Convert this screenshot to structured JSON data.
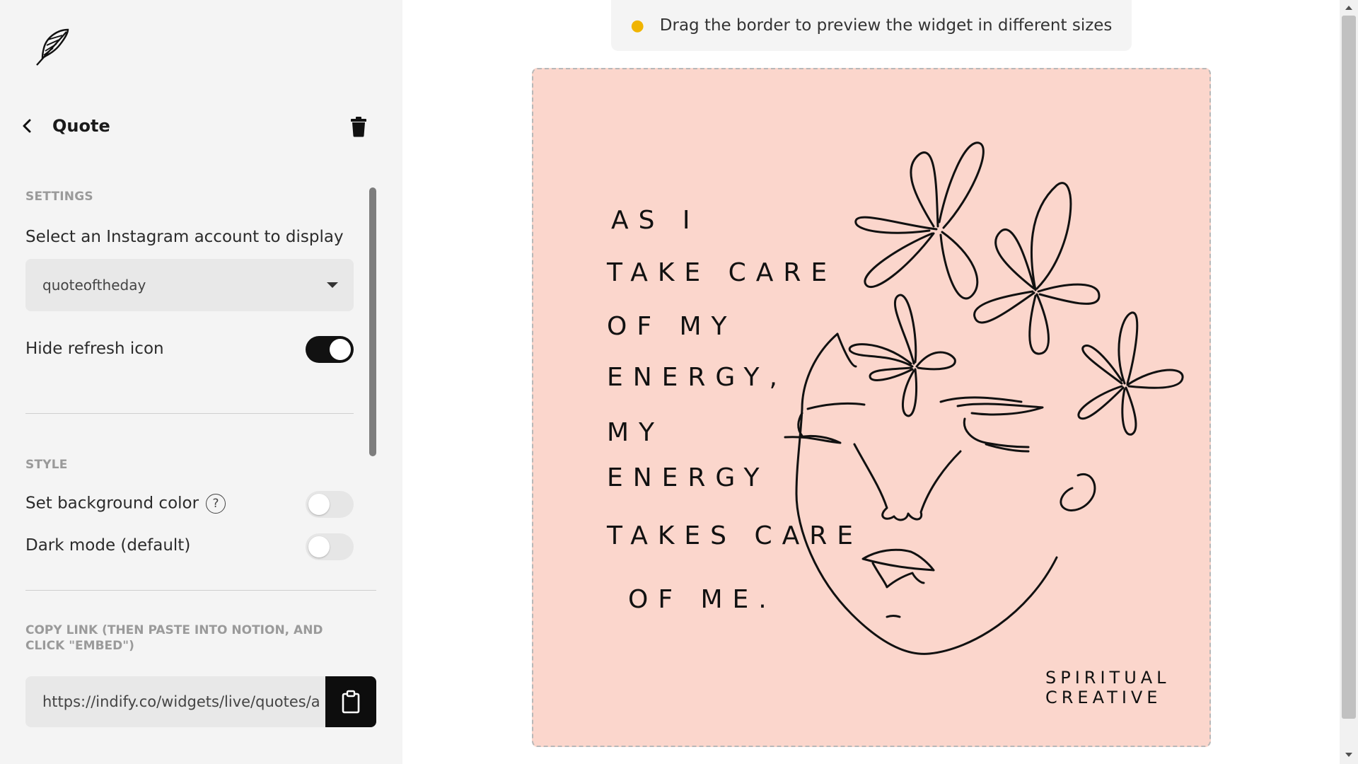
{
  "sidebar": {
    "logo_icon": "feather-icon",
    "back_icon": "chevron-left-icon",
    "title": "Quote",
    "delete_icon": "trash-icon",
    "settings": {
      "section_label": "SETTINGS",
      "account_label": "Select an Instagram account to display",
      "account_value": "quoteoftheday",
      "hide_refresh_label": "Hide refresh icon",
      "hide_refresh_on": true
    },
    "style": {
      "section_label": "STYLE",
      "background_color_label": "Set background color",
      "background_color_on": false,
      "help_icon": "question-circle-icon",
      "help_glyph": "?",
      "dark_mode_label": "Dark mode (default)",
      "dark_mode_on": false
    },
    "copy": {
      "label": "COPY LINK (THEN PASTE INTO NOTION, AND CLICK \"EMBED\")",
      "url": "https://indify.co/widgets/live/quotes/a",
      "copy_icon": "clipboard-icon"
    }
  },
  "main": {
    "hint_icon": "lightbulb-icon",
    "hint_text": "Drag the border to preview the widget in different sizes",
    "preview": {
      "background": "#fbd6cc",
      "quote_lines": [
        "AS I",
        "TAKE CARE",
        "OF MY",
        "ENERGY,",
        "MY",
        "ENERGY",
        "TAKES CARE",
        "OF ME."
      ],
      "brand_lines": [
        "SPIRITUAL",
        "CREATIVE"
      ]
    }
  },
  "colors": {
    "sidebar_bg": "#f4f4f4",
    "toggle_on": "#111111",
    "toggle_off": "#e6e6e6",
    "preview_bg": "#fbd6cc"
  }
}
